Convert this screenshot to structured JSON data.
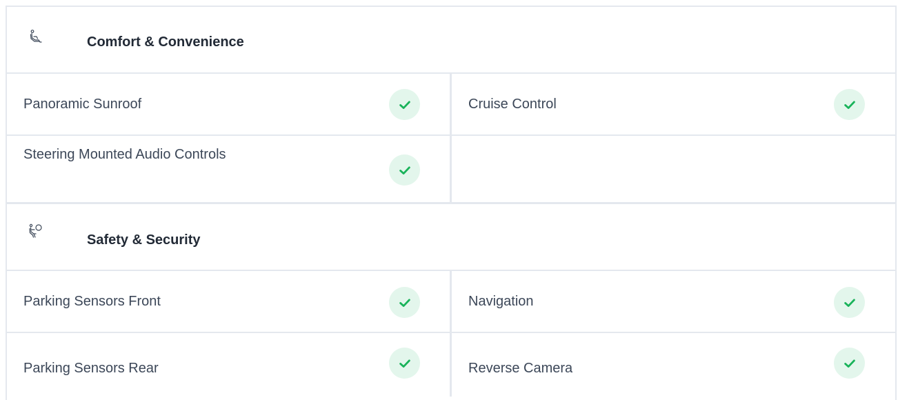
{
  "sections": [
    {
      "title": "Comfort & Convenience",
      "icon": "seat-icon",
      "rows": [
        {
          "left": {
            "label": "Panoramic Sunroof",
            "available": true
          },
          "right": {
            "label": "Cruise Control",
            "available": true
          }
        },
        {
          "left": {
            "label": "Steering Mounted Audio Controls",
            "available": true
          },
          "right": null
        }
      ]
    },
    {
      "title": "Safety & Security",
      "icon": "airbag-icon",
      "rows": [
        {
          "left": {
            "label": "Parking Sensors Front",
            "available": true
          },
          "right": {
            "label": "Navigation",
            "available": true
          }
        },
        {
          "left": {
            "label": "Parking Sensors Rear",
            "available": true
          },
          "right": {
            "label": "Reverse Camera",
            "available": true
          }
        }
      ]
    }
  ],
  "colors": {
    "check": "#19b35a",
    "check_bg": "#e3f6ec",
    "border": "#e4e8ee",
    "title": "#222a36",
    "text": "#3c4758"
  }
}
